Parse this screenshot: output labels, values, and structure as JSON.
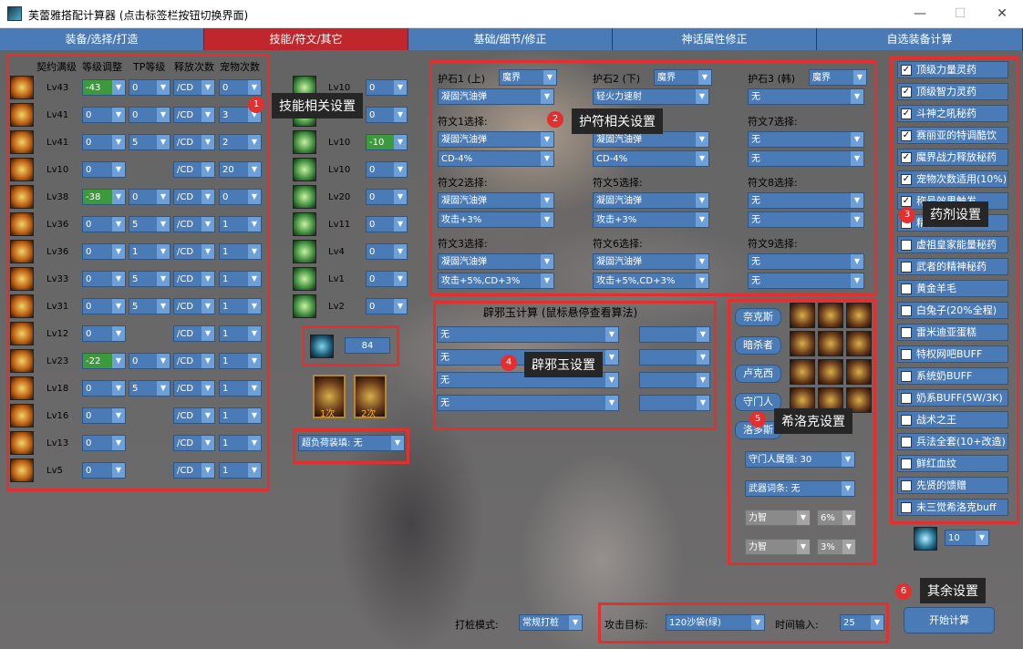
{
  "window": {
    "title": "芙蕾雅搭配计算器 (点击标签栏按钮切换界面)",
    "minimize": "—",
    "maximize": "☐",
    "close": "✕"
  },
  "tabs": [
    {
      "label": "装备/选择/打造"
    },
    {
      "label": "技能/符文/其它"
    },
    {
      "label": "基础/细节/修正"
    },
    {
      "label": "神话属性修正"
    },
    {
      "label": "自选装备计算"
    }
  ],
  "skills": {
    "headers": {
      "level": "契约满级",
      "adjust": "等级调整",
      "tp": "TP等级",
      "cast": "释放次数",
      "pet": "宠物次数"
    },
    "rows": [
      {
        "lv": "Lv43",
        "adj": "-43",
        "adj_green": true,
        "tp": "0",
        "cd": "/CD",
        "pet": "0"
      },
      {
        "lv": "Lv41",
        "adj": "0",
        "adj_green": false,
        "tp": "0",
        "cd": "/CD",
        "pet": "3"
      },
      {
        "lv": "Lv41",
        "adj": "0",
        "adj_green": false,
        "tp": "5",
        "cd": "/CD",
        "pet": "2"
      },
      {
        "lv": "Lv10",
        "adj": "0",
        "adj_green": false,
        "tp": "",
        "cd": "/CD",
        "pet": "20"
      },
      {
        "lv": "Lv38",
        "adj": "-38",
        "adj_green": true,
        "tp": "0",
        "cd": "/CD",
        "pet": "0"
      },
      {
        "lv": "Lv36",
        "adj": "0",
        "adj_green": false,
        "tp": "5",
        "cd": "/CD",
        "pet": "1"
      },
      {
        "lv": "Lv36",
        "adj": "0",
        "adj_green": false,
        "tp": "1",
        "cd": "/CD",
        "pet": "1"
      },
      {
        "lv": "Lv33",
        "adj": "0",
        "adj_green": false,
        "tp": "5",
        "cd": "/CD",
        "pet": "1"
      },
      {
        "lv": "Lv31",
        "adj": "0",
        "adj_green": false,
        "tp": "5",
        "cd": "/CD",
        "pet": "1"
      },
      {
        "lv": "Lv12",
        "adj": "0",
        "adj_green": false,
        "tp": "",
        "cd": "/CD",
        "pet": "1"
      },
      {
        "lv": "Lv23",
        "adj": "-22",
        "adj_green": true,
        "tp": "0",
        "cd": "/CD",
        "pet": "1"
      },
      {
        "lv": "Lv18",
        "adj": "0",
        "adj_green": false,
        "tp": "5",
        "cd": "/CD",
        "pet": "1"
      },
      {
        "lv": "Lv16",
        "adj": "0",
        "adj_green": false,
        "tp": "",
        "cd": "/CD",
        "pet": "1"
      },
      {
        "lv": "Lv13",
        "adj": "0",
        "adj_green": false,
        "tp": "",
        "cd": "/CD",
        "pet": "1"
      },
      {
        "lv": "Lv5",
        "adj": "0",
        "adj_green": false,
        "tp": "",
        "cd": "/CD",
        "pet": "1"
      }
    ]
  },
  "passives": [
    {
      "lv": "Lv10",
      "val": "0",
      "green": false
    },
    {
      "lv": "Lv10",
      "val": "0",
      "green": false
    },
    {
      "lv": "Lv10",
      "val": "-10",
      "green": true
    },
    {
      "lv": "Lv10",
      "val": "0",
      "green": false
    },
    {
      "lv": "Lv20",
      "val": "0",
      "green": false
    },
    {
      "lv": "Lv11",
      "val": "0",
      "green": false
    },
    {
      "lv": "Lv4",
      "val": "0",
      "green": false
    },
    {
      "lv": "Lv1",
      "val": "0",
      "green": false
    },
    {
      "lv": "Lv2",
      "val": "0",
      "green": false
    }
  ],
  "misc": {
    "pet_value": "84",
    "counter1": "1次",
    "counter2": "2次",
    "overload_label": "超负荷装填:",
    "overload_value": "无"
  },
  "talismans": [
    {
      "title": "护石1 (上)",
      "type": "魔界",
      "skill": "凝固汽油弹",
      "runes": [
        {
          "label": "符文1选择:",
          "skill": "凝固汽油弹",
          "effect": "CD-4%"
        },
        {
          "label": "符文2选择:",
          "skill": "凝固汽油弹",
          "effect": "攻击+3%"
        },
        {
          "label": "符文3选择:",
          "skill": "凝固汽油弹",
          "effect": "攻击+5%,CD+3%"
        }
      ]
    },
    {
      "title": "护石2 (下)",
      "type": "魔界",
      "skill": "轻火力速射",
      "runes": [
        {
          "label": "",
          "skill": "凝固汽油弹",
          "effect": "CD-4%"
        },
        {
          "label": "符文5选择:",
          "skill": "凝固汽油弹",
          "effect": "攻击+3%"
        },
        {
          "label": "符文6选择:",
          "skill": "凝固汽油弹",
          "effect": "攻击+5%,CD+3%"
        }
      ]
    },
    {
      "title": "护石3 (韩)",
      "type": "魔界",
      "skill": "无",
      "runes": [
        {
          "label": "符文7选择:",
          "skill": "无",
          "effect": "无"
        },
        {
          "label": "符文8选择:",
          "skill": "无",
          "effect": "无"
        },
        {
          "label": "符文9选择:",
          "skill": "无",
          "effect": "无"
        }
      ]
    }
  ],
  "pixie": {
    "title": "辟邪玉计算 (鼠标悬停查看算法)",
    "rows": [
      {
        "value": "无"
      },
      {
        "value": "无"
      },
      {
        "value": "无"
      },
      {
        "value": "无"
      }
    ]
  },
  "hiroc": {
    "buttons": [
      {
        "label": "奈克斯"
      },
      {
        "label": "暗杀者"
      },
      {
        "label": "卢克西"
      },
      {
        "label": "守门人"
      },
      {
        "label": "洛多斯"
      }
    ],
    "gatekeeper": "守门人属强: 30",
    "weapon": "武器词条: 无",
    "attr1": "力智",
    "pct1": "6%",
    "attr2": "力智",
    "pct2": "3%"
  },
  "consumables": [
    {
      "label": "顶级力量灵药",
      "checked": true
    },
    {
      "label": "顶级智力灵药",
      "checked": true
    },
    {
      "label": "斗神之吼秘药",
      "checked": true
    },
    {
      "label": "赛丽亚的特调酷饮",
      "checked": true
    },
    {
      "label": "魔界战力释放秘药",
      "checked": true
    },
    {
      "label": "宠物次数适用(10%)",
      "checked": true
    },
    {
      "label": "称号效果触发",
      "checked": true
    },
    {
      "label": "精神",
      "checked": false
    },
    {
      "label": "虚祖皇家能量秘药",
      "checked": false
    },
    {
      "label": "武者的精神秘药",
      "checked": false
    },
    {
      "label": "黄金羊毛",
      "checked": false
    },
    {
      "label": "白兔子(20%全程)",
      "checked": false
    },
    {
      "label": "雷米迪亚蛋糕",
      "checked": false
    },
    {
      "label": "特权网吧BUFF",
      "checked": false
    },
    {
      "label": "系统奶BUFF",
      "checked": false
    },
    {
      "label": "奶系BUFF(5W/3K)",
      "checked": false
    },
    {
      "label": "战术之王",
      "checked": false
    },
    {
      "label": "兵法全套(10+改造)",
      "checked": false
    },
    {
      "label": "鲜红血纹",
      "checked": false
    },
    {
      "label": "先贤的馈赠",
      "checked": false
    },
    {
      "label": "未三觉希洛克buff",
      "checked": false
    }
  ],
  "extra": {
    "level_value": "10",
    "mode_label": "打桩模式:",
    "mode_value": "常规打桩",
    "target_label": "攻击目标:",
    "target_value": "120沙袋(绿)",
    "time_label": "时间输入:",
    "time_value": "25",
    "start_button": "开始计算"
  },
  "callouts": [
    {
      "num": "1",
      "text": "技能相关设置"
    },
    {
      "num": "2",
      "text": "护符相关设置"
    },
    {
      "num": "3",
      "text": "药剂设置"
    },
    {
      "num": "4",
      "text": "辟邪玉设置"
    },
    {
      "num": "5",
      "text": "希洛克设置"
    },
    {
      "num": "6",
      "text": "其余设置"
    }
  ],
  "colors": {
    "accent_blue": "#4a7bb6",
    "active_tab": "#c0272d",
    "highlight_border": "#e23030",
    "green_value": "#3c9a3c"
  }
}
